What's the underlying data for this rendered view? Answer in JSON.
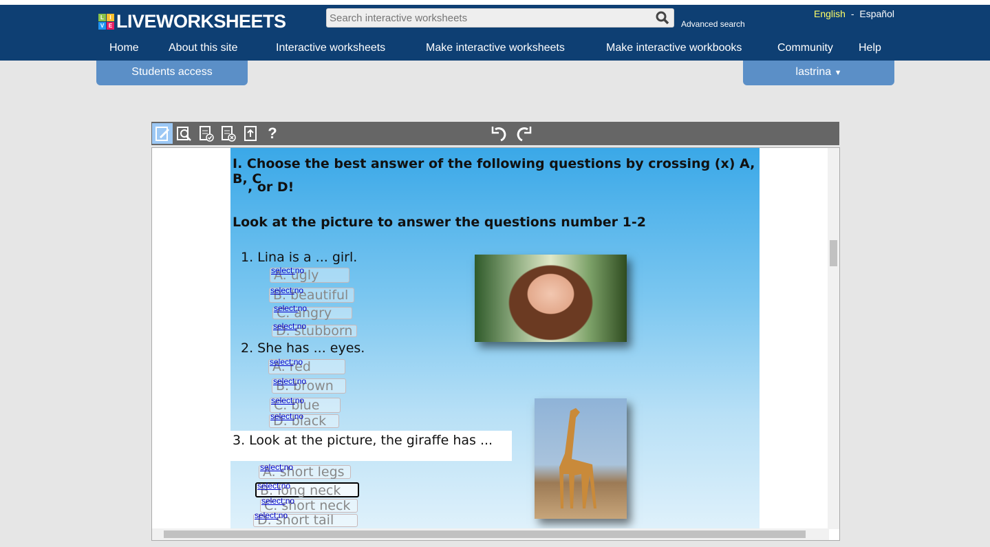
{
  "header": {
    "logo": "LIVEWORKSHEETS",
    "logo_tiles": [
      "L",
      "I",
      "V",
      "E"
    ],
    "search_placeholder": "Search interactive worksheets",
    "advanced_search": "Advanced search",
    "lang_en": "English",
    "lang_sep": "-",
    "lang_es": "Español"
  },
  "nav": [
    "Home",
    "About this site",
    "Interactive worksheets",
    "Make interactive worksheets",
    "Make interactive workbooks",
    "Community",
    "Help"
  ],
  "students_access": "Students access",
  "user": "lastrina",
  "toolbar": {
    "help": "?",
    "icons": [
      "edit-icon",
      "preview-icon",
      "check-answers-icon",
      "clear-answers-icon",
      "upload-icon",
      "help-icon",
      "undo-icon",
      "redo-icon"
    ]
  },
  "worksheet": {
    "instruction1": "I.  Choose the best answer of the following questions by crossing (x) A, B, C",
    "instruction1b": ", or D!",
    "instruction2": "Look at the picture to answer the questions number 1-2",
    "q1": "1.   Lina is a ... girl.",
    "q2": "2.  She has ... eyes.",
    "q3": "3.    Look at the picture, the giraffe has ...",
    "select_label": "select:",
    "select_value": "no",
    "q1_options": [
      "A. ugly",
      "B. beautiful",
      "C. angry",
      "D. stubborn"
    ],
    "q2_options": [
      "A. red",
      "B. brown",
      "C. blue",
      "D. black"
    ],
    "q3_options": [
      "A. short legs",
      "B. long neck",
      "C. short neck",
      "D. short tail"
    ]
  },
  "colors": {
    "header": "#0e3f73",
    "button": "#5b8fc7",
    "toolbar": "#666666",
    "active_tool": "#9cc8f5"
  }
}
